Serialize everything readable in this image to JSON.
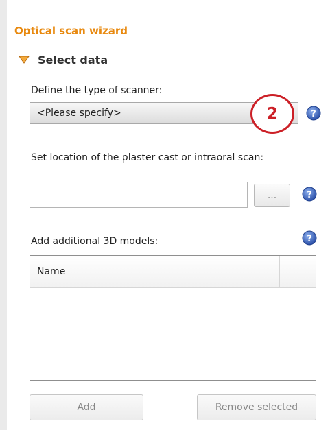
{
  "wizard": {
    "title": "Optical scan wizard",
    "section": {
      "label": "Select data",
      "expanded": true
    }
  },
  "scanner": {
    "label": "Define the type of scanner:",
    "selected": "<Please specify>"
  },
  "callout": {
    "number": "2",
    "color": "#cc2027"
  },
  "location": {
    "label": "Set location of the plaster cast or intraoral scan:",
    "value": "",
    "browse_label": "..."
  },
  "models": {
    "label": "Add additional 3D models:",
    "columns": [
      "Name",
      ""
    ],
    "rows": []
  },
  "buttons": {
    "add": "Add",
    "remove": "Remove selected"
  },
  "colors": {
    "accent": "#e8890f",
    "help": "#3f64b8"
  },
  "icons": {
    "help": "help-icon",
    "expand": "triangle-down-icon"
  }
}
